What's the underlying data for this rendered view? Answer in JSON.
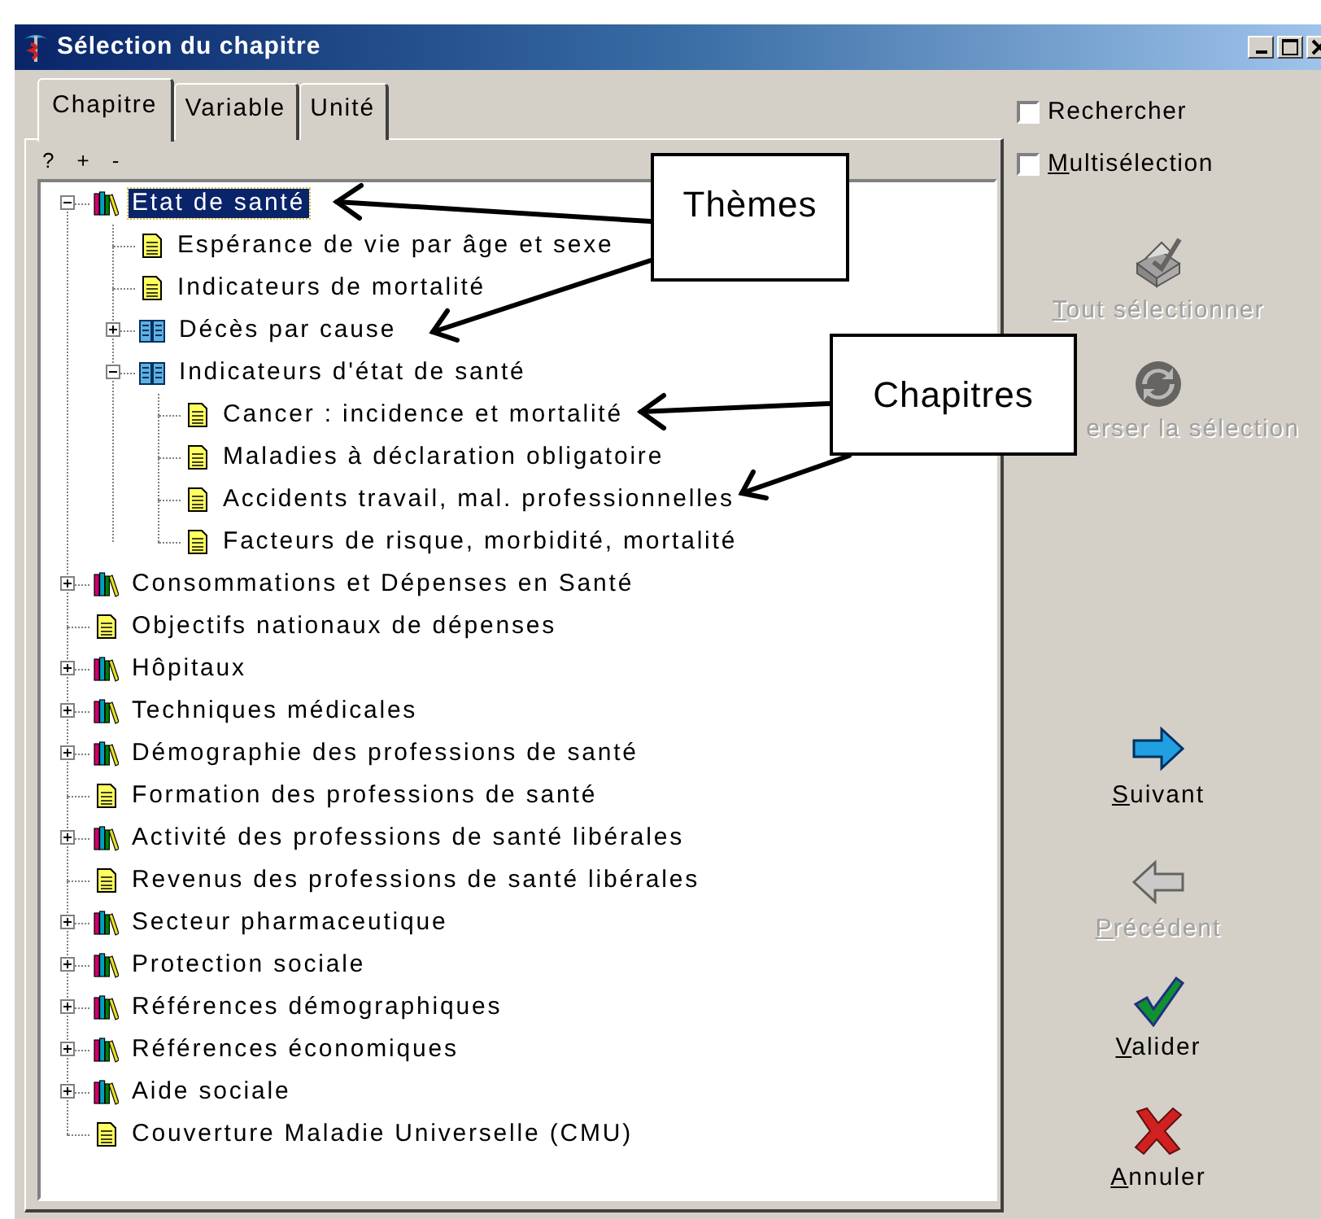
{
  "window": {
    "title": "Sélection du chapitre"
  },
  "tabs": [
    {
      "label": "Chapitre",
      "selected": true
    },
    {
      "label": "Variable",
      "selected": false
    },
    {
      "label": "Unité",
      "selected": false
    }
  ],
  "toolbar": [
    "?",
    "+",
    "-"
  ],
  "tree": [
    {
      "label": "Etat de santé",
      "kind": "theme",
      "expanded": true,
      "selected": true,
      "children": [
        {
          "label": "Espérance de vie par âge et sexe",
          "kind": "chapter",
          "selected": false
        },
        {
          "label": "Indicateurs de mortalité",
          "kind": "chapter",
          "selected": false
        },
        {
          "label": "Décès par cause",
          "kind": "group",
          "expanded": false,
          "selected": false
        },
        {
          "label": "Indicateurs d'état de santé",
          "kind": "group",
          "expanded": true,
          "selected": false,
          "children": [
            {
              "label": "Cancer : incidence et mortalité",
              "kind": "chapter",
              "selected": false
            },
            {
              "label": "Maladies à déclaration obligatoire",
              "kind": "chapter",
              "selected": false
            },
            {
              "label": "Accidents travail, mal. professionnelles",
              "kind": "chapter",
              "selected": false
            },
            {
              "label": "Facteurs de risque, morbidité, mortalité",
              "kind": "chapter",
              "selected": false
            }
          ]
        }
      ]
    },
    {
      "label": "Consommations et Dépenses en Santé",
      "kind": "theme",
      "expanded": false,
      "selected": false
    },
    {
      "label": "Objectifs nationaux de dépenses",
      "kind": "chapter",
      "selected": false
    },
    {
      "label": "Hôpitaux",
      "kind": "theme",
      "expanded": false,
      "selected": false
    },
    {
      "label": "Techniques médicales",
      "kind": "theme",
      "expanded": false,
      "selected": false
    },
    {
      "label": "Démographie des professions de santé",
      "kind": "theme",
      "expanded": false,
      "selected": false
    },
    {
      "label": "Formation des professions de santé",
      "kind": "chapter",
      "selected": false
    },
    {
      "label": "Activité des professions de santé libérales",
      "kind": "theme",
      "expanded": false,
      "selected": false
    },
    {
      "label": "Revenus des professions de santé libérales",
      "kind": "chapter",
      "selected": false
    },
    {
      "label": "Secteur pharmaceutique",
      "kind": "theme",
      "expanded": false,
      "selected": false
    },
    {
      "label": "Protection sociale",
      "kind": "theme",
      "expanded": false,
      "selected": false
    },
    {
      "label": "Références démographiques",
      "kind": "theme",
      "expanded": false,
      "selected": false
    },
    {
      "label": "Références économiques",
      "kind": "theme",
      "expanded": false,
      "selected": false
    },
    {
      "label": "Aide sociale",
      "kind": "theme",
      "expanded": false,
      "selected": false
    },
    {
      "label": "Couverture Maladie Universelle (CMU)",
      "kind": "chapter",
      "selected": false
    }
  ],
  "options": [
    {
      "label": "Rechercher",
      "checked": false,
      "underline_first": false
    },
    {
      "label": "Multisélection",
      "checked": false,
      "underline_first": true
    }
  ],
  "actions": [
    {
      "kind": "select-all",
      "label": "Tout sélectionner",
      "disabled": true,
      "underline_first": true
    },
    {
      "kind": "invert",
      "label": "erser la sélection",
      "disabled": true,
      "underline_first": false
    },
    {
      "kind": "next",
      "label": "Suivant",
      "disabled": false,
      "underline_first": true
    },
    {
      "kind": "previous",
      "label": "Précédent",
      "disabled": true,
      "underline_first": true
    },
    {
      "kind": "validate",
      "label": "Valider",
      "disabled": false,
      "underline_first": true
    },
    {
      "kind": "cancel",
      "label": "Annuler",
      "disabled": false,
      "underline_first": true
    }
  ],
  "callouts": [
    {
      "text": "Thèmes"
    },
    {
      "text": "Chapitres"
    }
  ]
}
